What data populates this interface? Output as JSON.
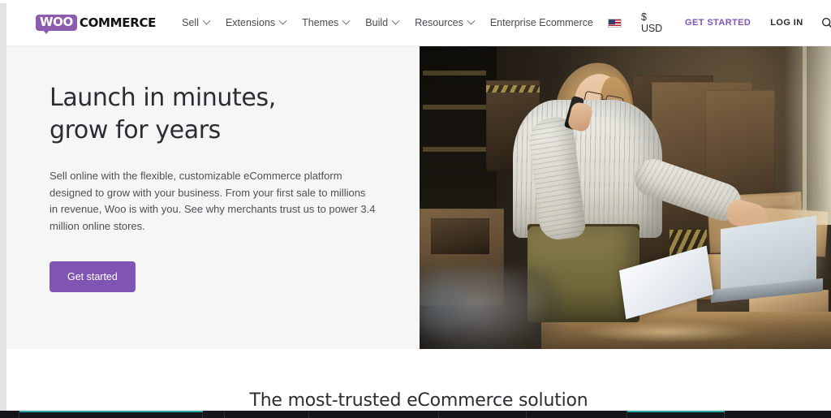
{
  "header": {
    "logo": {
      "badge_text": "WOO",
      "word_text": "COMMERCE",
      "brand_color": "#8d5bb0"
    },
    "nav_items": [
      {
        "label": "Sell",
        "has_caret": true
      },
      {
        "label": "Extensions",
        "has_caret": true
      },
      {
        "label": "Themes",
        "has_caret": true
      },
      {
        "label": "Build",
        "has_caret": true
      },
      {
        "label": "Resources",
        "has_caret": true
      },
      {
        "label": "Enterprise Ecommerce",
        "has_caret": false
      }
    ],
    "locale": {
      "flag": "us-flag-icon",
      "label": ""
    },
    "currency": {
      "label": "$ USD"
    },
    "get_started_label": "GET STARTED",
    "log_in_label": "LOG IN",
    "search_icon": "search-icon",
    "accent_color": "#7f54b3"
  },
  "hero": {
    "title_line1": "Launch in minutes,",
    "title_line2": "grow for years",
    "paragraph": "Sell online with the flexible, customizable eCommerce platform designed to grow with your business. From your first sale to millions in revenue, Woo is with you. See why merchants trust us to power 3.4 million online stores.",
    "button_label": "Get started",
    "button_color": "#7f54b3",
    "background_color": "#f6f6f6",
    "image_alt": "woman-on-phone-packing-boxes-photo"
  },
  "section_trust": {
    "title": "The most-trusted eCommerce solution"
  }
}
